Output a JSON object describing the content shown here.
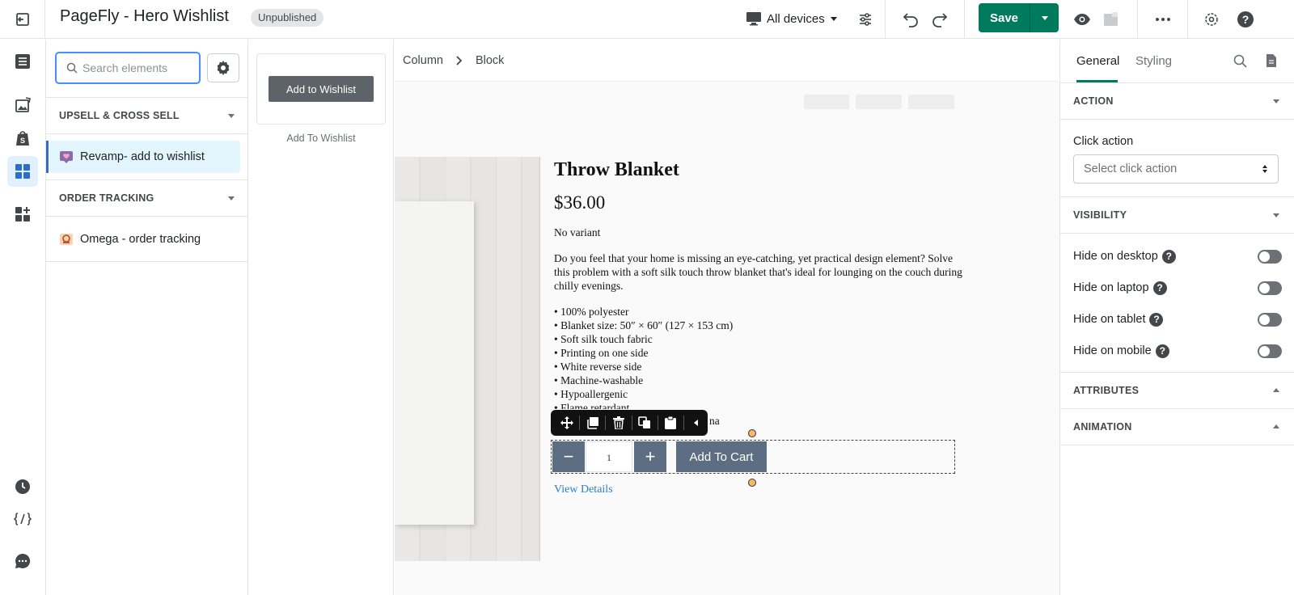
{
  "topbar": {
    "title": "PageFly - Hero Wishlist",
    "status_badge": "Unpublished",
    "device_selector": "All devices",
    "save_label": "Save"
  },
  "panel": {
    "search_placeholder": "Search elements",
    "sections": [
      {
        "title": "UPSELL & CROSS SELL",
        "items": [
          {
            "label": "Revamp- add to wishlist"
          }
        ]
      },
      {
        "title": "ORDER TRACKING",
        "items": [
          {
            "label": "Omega - order tracking"
          }
        ]
      }
    ]
  },
  "preview": {
    "button_label": "Add to Wishlist",
    "caption": "Add To Wishlist"
  },
  "canvas": {
    "breadcrumbs": [
      "Column",
      "Block"
    ],
    "product": {
      "title": "Throw Blanket",
      "price": "$36.00",
      "variant": "No variant",
      "description": "Do you feel that your home is missing an eye-catching, yet practical design element? Solve this problem with a soft silk touch throw blanket that's ideal for lounging on the couch during chilly evenings.",
      "bullets": [
        "• 100% polyester",
        "• Blanket size: 50″ × 60″ (127 × 153 cm)",
        "• Soft silk touch fabric",
        "• Printing on one side",
        "• White reverse side",
        "• Machine-washable",
        "• Hypoallergenic",
        "• Flame retardant"
      ],
      "bullet_fragment": "na",
      "quantity": "1",
      "minus": "−",
      "plus": "+",
      "add_to_cart": "Add To Cart",
      "view_details": "View Details"
    }
  },
  "inspector": {
    "tabs": [
      "General",
      "Styling"
    ],
    "sections": {
      "action": "ACTION",
      "visibility": "VISIBILITY",
      "attributes": "ATTRIBUTES",
      "animation": "ANIMATION"
    },
    "click_action_label": "Click action",
    "click_action_placeholder": "Select click action",
    "visibility_toggles": [
      "Hide on desktop",
      "Hide on laptop",
      "Hide on tablet",
      "Hide on mobile"
    ],
    "help_glyph": "?"
  },
  "colors": {
    "save": "#007a5c",
    "active_rail": "#e3f1ff",
    "selected_item": "#e3f6fd",
    "search_focus": "#458fff",
    "link": "#2a7fc9",
    "handle": "#f7b967"
  }
}
